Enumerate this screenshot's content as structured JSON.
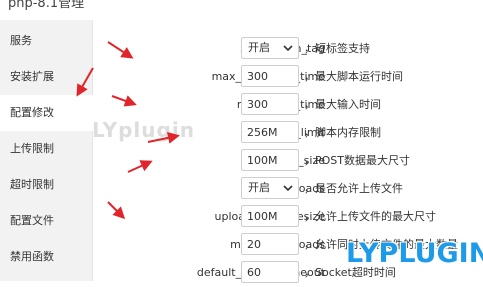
{
  "window": {
    "title": "php-8.1管理"
  },
  "sidebar": {
    "items": [
      {
        "label": "服务"
      },
      {
        "label": "安装扩展"
      },
      {
        "label": "配置修改",
        "active": true
      },
      {
        "label": "上传限制"
      },
      {
        "label": "超时限制"
      },
      {
        "label": "配置文件"
      },
      {
        "label": "禁用函数"
      }
    ]
  },
  "settings": [
    {
      "name": "short_open_tag",
      "type": "select",
      "value": "开启",
      "desc": "，短标签支持"
    },
    {
      "name": "max_execution_time",
      "type": "input",
      "value": "300",
      "desc": "，最大脚本运行时间"
    },
    {
      "name": "max_input_time",
      "type": "input",
      "value": "300",
      "desc": "，最大输入时间"
    },
    {
      "name": "memory_limit",
      "type": "input",
      "value": "256M",
      "desc": "，脚本内存限制"
    },
    {
      "name": "post_max_size",
      "type": "input",
      "value": "100M",
      "desc": "，POST数据最大尺寸"
    },
    {
      "name": "file_uploads",
      "type": "select",
      "value": "开启",
      "desc": "，是否允许上传文件"
    },
    {
      "name": "upload_max_filesize",
      "type": "input",
      "value": "100M",
      "desc": "，允许上传文件的最大尺寸"
    },
    {
      "name": "max_file_uploads",
      "type": "input",
      "value": "20",
      "desc": "，允许同时上传文件的最大数量"
    },
    {
      "name": "default_socket_timeout",
      "type": "input",
      "value": "60",
      "desc": "，Socket超时时间"
    }
  ],
  "overlay": {
    "watermark": "LYplugin",
    "logo": "LYPLUGIN",
    "annotation_arrow_color": "#e0262a",
    "logo_color": "#1e9be8"
  }
}
